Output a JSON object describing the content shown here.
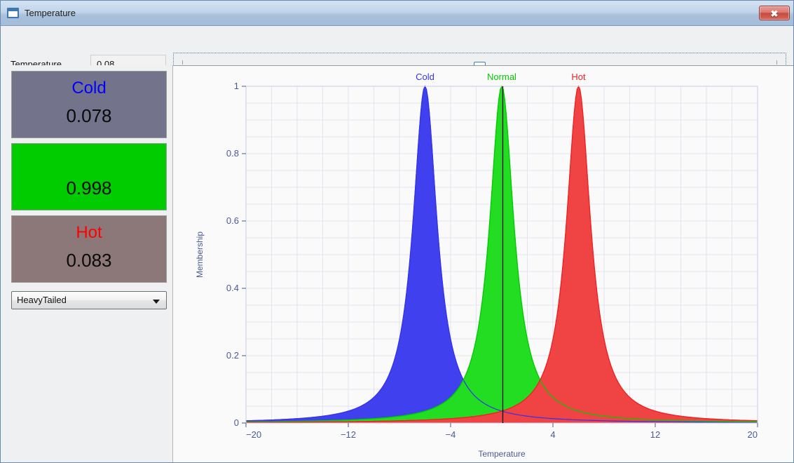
{
  "window": {
    "title": "Temperature",
    "icon": "window-icon",
    "close_label": "✖"
  },
  "controls": {
    "temperature_label": "Temperature",
    "temperature_value": "0.08",
    "slider": {
      "name": "temperature-slider",
      "value": 0.08,
      "min": -20,
      "max": 20
    },
    "membership_function_select": {
      "selected": "HeavyTailed",
      "options": [
        "HeavyTailed"
      ]
    }
  },
  "fuzzy_sets": [
    {
      "key": "cold",
      "name": "Cold",
      "value": "0.078",
      "name_color": "#0000ff",
      "box_color": "#73738c"
    },
    {
      "key": "normal",
      "name": "Normal",
      "value": "0.998",
      "name_color": "#00cc00",
      "box_color": "#00cc00"
    },
    {
      "key": "hot",
      "name": "Hot",
      "value": "0.083",
      "name_color": "#ff0000",
      "box_color": "#8c7878"
    }
  ],
  "chart_data": {
    "type": "area",
    "title": "",
    "xlabel": "Temperature",
    "ylabel": "Membership",
    "xlim": [
      -20,
      20
    ],
    "ylim": [
      0,
      1
    ],
    "xticks": [
      -20,
      -12,
      -4,
      4,
      12,
      20
    ],
    "xticklabels": [
      "-20",
      "-12",
      "-4",
      "4",
      "12",
      "20"
    ],
    "yticks": [
      0,
      0.2,
      0.4,
      0.6,
      0.8,
      1
    ],
    "yticklabels": [
      "0",
      "0.2",
      "0.4",
      "0.6",
      "0.8",
      "1"
    ],
    "grid": true,
    "legend_position": "top",
    "cursor": {
      "x": 0.08,
      "color": "#000000",
      "label": "current-temperature"
    },
    "series": [
      {
        "name": "Cold",
        "color": "#3333ee",
        "fill": "#4040ee",
        "peak_x": -6,
        "peak_y": 1,
        "gamma": 1.15,
        "value_at_cursor": 0.078
      },
      {
        "name": "Normal",
        "color": "#00cc00",
        "fill": "#22dd22",
        "peak_x": 0,
        "peak_y": 1,
        "gamma": 1.15,
        "value_at_cursor": 0.998
      },
      {
        "name": "Hot",
        "color": "#ee2222",
        "fill": "#f04343",
        "peak_x": 6,
        "peak_y": 1,
        "gamma": 1.15,
        "value_at_cursor": 0.083
      }
    ]
  }
}
